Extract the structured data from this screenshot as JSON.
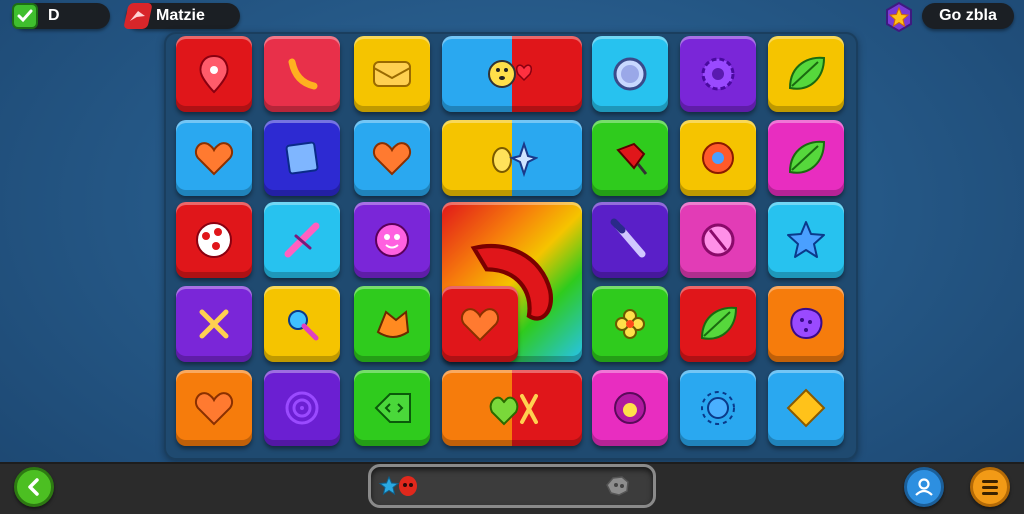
{
  "hud": {
    "left_label": "D",
    "mode_label": "Matzie",
    "right_label": "Go zbla"
  },
  "board": {
    "rows": 5,
    "cols": 8,
    "tiles": [
      {
        "name": "tile-balloon",
        "color": "red",
        "icon": "balloon-icon"
      },
      {
        "name": "tile-banana",
        "color": "crimson",
        "icon": "banana-icon"
      },
      {
        "name": "tile-envelope",
        "color": "yellow",
        "icon": "envelope-icon"
      },
      {
        "name": "tile-bear-heart",
        "color": "blue-red",
        "icon": "bear-face-icon"
      },
      {
        "name": "tile-ring",
        "color": "cyan",
        "icon": "ring-icon"
      },
      {
        "name": "tile-gear",
        "color": "purple",
        "icon": "gear-icon"
      },
      {
        "name": "tile-leaf",
        "color": "yellow",
        "icon": "leaf-icon"
      },
      {
        "name": "tile-heart-orange",
        "color": "sky",
        "icon": "heart-icon"
      },
      {
        "name": "tile-square",
        "color": "navy",
        "icon": "square-gem-icon"
      },
      {
        "name": "tile-heart-small",
        "color": "sky",
        "icon": "heart-icon"
      },
      {
        "name": "tile-bird-star",
        "color": "yellow-blue",
        "icon": "bird-icon"
      },
      {
        "name": "tile-pin",
        "color": "green",
        "icon": "pushpin-icon"
      },
      {
        "name": "tile-donut",
        "color": "yellow",
        "icon": "donut-icon"
      },
      {
        "name": "tile-leaf-magenta",
        "color": "magenta",
        "icon": "leaf-icon"
      },
      {
        "name": "tile-dice",
        "color": "red",
        "icon": "dots-icon"
      },
      {
        "name": "tile-cross-pink",
        "color": "cyan",
        "icon": "cross-icon"
      },
      {
        "name": "tile-face",
        "color": "purple",
        "icon": "smiley-icon"
      },
      {
        "name": "tile-rainbow-swirl",
        "color": "rainbow",
        "icon": "swirl-icon"
      },
      {
        "name": "tile-brush",
        "color": "indigo",
        "icon": "brush-icon"
      },
      {
        "name": "tile-no-sign",
        "color": "pink",
        "icon": "no-sign-icon"
      },
      {
        "name": "tile-star",
        "color": "cyan",
        "icon": "star-icon"
      },
      {
        "name": "tile-x-purple",
        "color": "purple",
        "icon": "x-icon"
      },
      {
        "name": "tile-key",
        "color": "yellow",
        "icon": "key-icon"
      },
      {
        "name": "tile-fox",
        "color": "green",
        "icon": "fox-icon"
      },
      {
        "name": "tile-heart-red",
        "color": "red",
        "icon": "heart-icon"
      },
      {
        "name": "tile-flower",
        "color": "green",
        "icon": "flower-icon"
      },
      {
        "name": "tile-leaf-red",
        "color": "red",
        "icon": "leaf-icon"
      },
      {
        "name": "tile-cookie",
        "color": "orange",
        "icon": "cookie-icon"
      },
      {
        "name": "tile-heart-lime",
        "color": "orange",
        "icon": "heart-icon"
      },
      {
        "name": "tile-spiral",
        "color": "violet",
        "icon": "spiral-icon"
      },
      {
        "name": "tile-arrow-box",
        "color": "green",
        "icon": "arrow-box-icon"
      },
      {
        "name": "tile-heart-x",
        "color": "orange-red",
        "icon": "heart-x-icon"
      },
      {
        "name": "tile-flower-pink",
        "color": "magenta",
        "icon": "blob-icon"
      },
      {
        "name": "tile-sun",
        "color": "sky",
        "icon": "sun-icon"
      },
      {
        "name": "tile-diamond",
        "color": "sky",
        "icon": "diamond-icon"
      }
    ]
  },
  "colors": {
    "red": "#e0161a",
    "crimson": "#e8304a",
    "yellow": "#f5c400",
    "cyan": "#27c2ef",
    "purple": "#7a26d8",
    "sky": "#2aa8f0",
    "navy": "#2d2ad2",
    "green": "#2fcb1d",
    "magenta": "#e82dc0",
    "indigo": "#5a1fc8",
    "pink": "#e23cb6",
    "orange": "#f67c0c",
    "violet": "#6b1fd2"
  },
  "bottom": {
    "back_icon": "chevron-left-icon",
    "profile_icon": "user-icon",
    "menu_icon": "hamburger-icon",
    "progress_icons": [
      "star-icon",
      "skull-icon",
      "rock-icon"
    ]
  }
}
